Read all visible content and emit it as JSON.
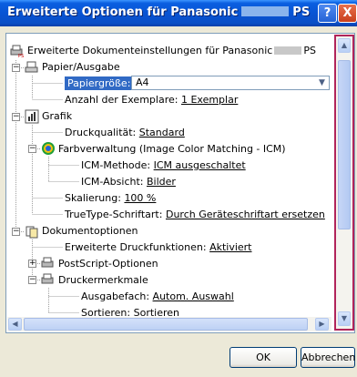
{
  "window": {
    "title_prefix": "Erweiterte Optionen für Panasonic",
    "title_suffix": "PS",
    "help_label": "?",
    "close_label": "X"
  },
  "tree": {
    "root_label": "Erweiterte Dokumenteinstellungen für Panasonic",
    "root_suffix": "PS",
    "paper_section": "Papier/Ausgabe",
    "paper_size_label": "Papiergröße:",
    "paper_size_value": "A4",
    "copies_label": "Anzahl der Exemplare:",
    "copies_value": "1 Exemplar",
    "graphics_section": "Grafik",
    "quality_label": "Druckqualität:",
    "quality_value": "Standard",
    "color_mgmt_label": "Farbverwaltung (Image Color Matching - ICM)",
    "icm_method_label": "ICM-Methode:",
    "icm_method_value": "ICM ausgeschaltet",
    "icm_intent_label": "ICM-Absicht:",
    "icm_intent_value": "Bilder",
    "scaling_label": "Skalierung:",
    "scaling_value": "100 %",
    "truetype_label": "TrueType-Schriftart:",
    "truetype_value": "Durch Geräteschriftart ersetzen",
    "doc_options_section": "Dokumentoptionen",
    "adv_print_label": "Erweiterte Druckfunktionen:",
    "adv_print_value": "Aktiviert",
    "postscript_label": "PostScript-Optionen",
    "printer_features_label": "Druckermerkmale",
    "output_tray_label": "Ausgabefach:",
    "output_tray_value": "Autom. Auswahl",
    "sort_label": "Sortieren:",
    "sort_value": "Sortieren"
  },
  "buttons": {
    "ok": "OK",
    "cancel": "Abbrechen"
  },
  "colors": {
    "title_bar": "#0854d4",
    "selection": "#316ac5",
    "scrollbar_highlight": "#b0245a"
  }
}
